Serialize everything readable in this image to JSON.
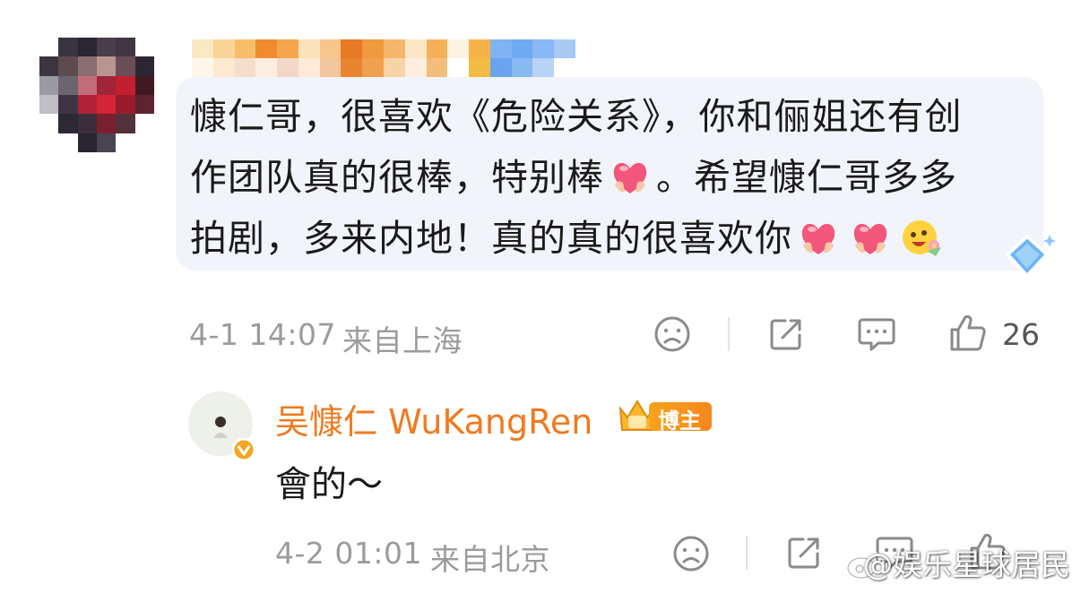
{
  "comment": {
    "text_line1": "慷仁哥，很喜欢《危险关系》，你和俪姐还有创",
    "text_line2a": "作团队真的很棒，特别棒",
    "text_line2b": "。希望慷仁哥多多",
    "text_line3": "拍剧，多来内地！真的真的很喜欢你",
    "timestamp": "4-1 14:07",
    "location": "来自上海",
    "like_count": "26"
  },
  "reply": {
    "author": "吴慷仁 WuKangRen",
    "badge_label": "博主",
    "text": "會的～",
    "timestamp": "4-2 01:01",
    "location": "来自北京"
  },
  "watermark": "@娱乐星球居民",
  "colors": {
    "author_orange": "#f07a1f",
    "bubble_bg": "#f2f4fb",
    "meta_gray": "#9b9b9b",
    "heart_pink": "#f2567a"
  },
  "icons": [
    "sad-face-icon",
    "share-icon",
    "comment-icon",
    "thumbs-up-icon",
    "heart-hands-emoji",
    "smiley-flower-emoji",
    "diamond-fan-badge-icon",
    "verified-v-icon",
    "crown-badge-icon",
    "weibo-logo-icon"
  ]
}
